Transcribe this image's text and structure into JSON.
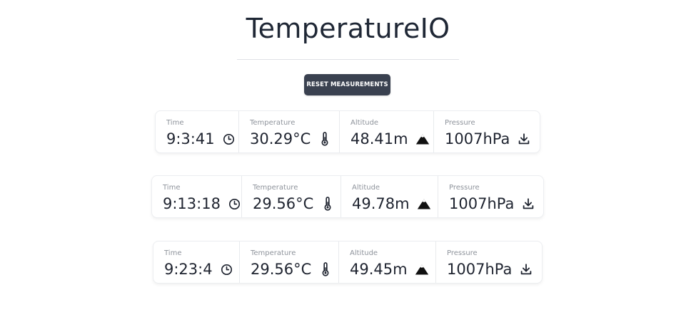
{
  "app": {
    "title": "TemperatureIO",
    "reset_label": "RESET MEASUREMENTS"
  },
  "labels": {
    "time": "Time",
    "temperature": "Temperature",
    "altitude": "Altitude",
    "pressure": "Pressure"
  },
  "icons": {
    "time": "clock-icon",
    "temperature": "thermometer-icon",
    "altitude": "mountain-icon",
    "pressure": "download-icon"
  },
  "measurements": [
    {
      "time": "9:3:41",
      "temperature": "30.29°C",
      "altitude": "48.41m",
      "pressure": "1007hPa"
    },
    {
      "time": "9:13:18",
      "temperature": "29.56°C",
      "altitude": "49.78m",
      "pressure": "1007hPa"
    },
    {
      "time": "9:23:4",
      "temperature": "29.56°C",
      "altitude": "49.45m",
      "pressure": "1007hPa"
    }
  ]
}
